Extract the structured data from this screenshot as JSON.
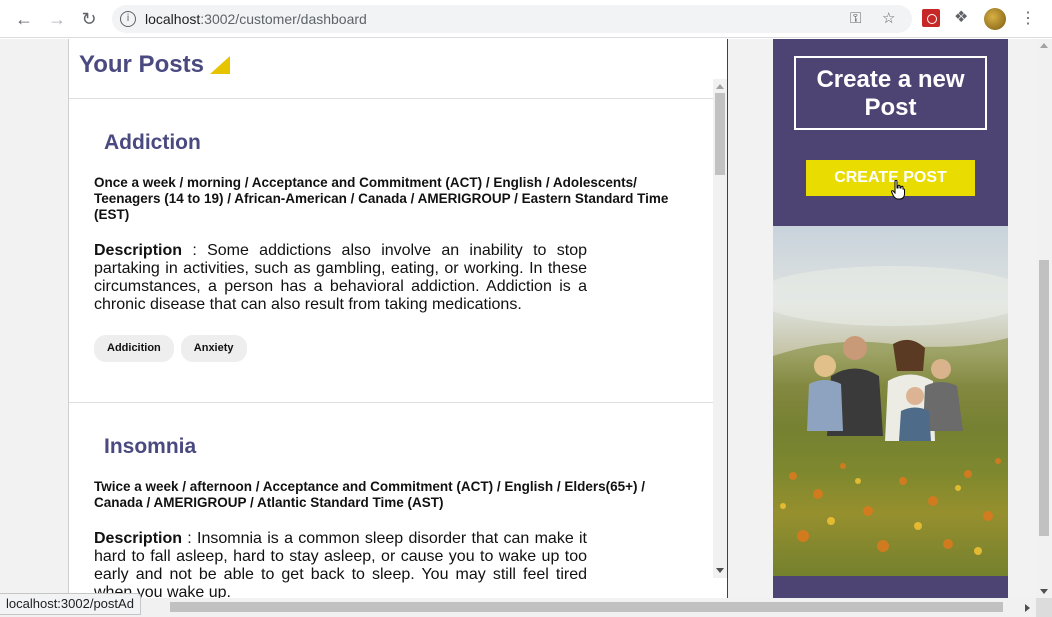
{
  "browser": {
    "url_host": "localhost",
    "url_path": ":3002/customer/dashboard",
    "status_url": "localhost:3002/postAd"
  },
  "panel": {
    "title": "Your Posts"
  },
  "posts": [
    {
      "title": "Addiction",
      "meta": "Once a week / morning / Acceptance and Commitment (ACT) / English / Adolescents/ Teenagers (14 to 19) / African-American / Canada / AMERIGROUP / Eastern Standard Time (EST)",
      "desc_label": "Description",
      "desc_text": " : Some addictions also involve an inability to stop partaking in activities, such as gambling, eating, or working. In these circumstances, a person has a behavioral addiction. Addiction is a chronic disease that can also result from taking medications.",
      "tags": [
        "Addicition",
        "Anxiety"
      ]
    },
    {
      "title": "Insomnia",
      "meta": "Twice a week / afternoon / Acceptance and Commitment (ACT) / English / Elders(65+) / Canada / AMERIGROUP / Atlantic Standard Time (AST)",
      "desc_label": "Description",
      "desc_text": " : Insomnia is a common sleep disorder that can make it hard to fall asleep, hard to stay asleep, or cause you to wake up too early and not be able to get back to sleep. You may still feel tired when you wake up."
    }
  ],
  "create_card": {
    "heading": "Create a new Post",
    "button_label": "CREATE POST"
  },
  "colors": {
    "brand_purple": "#4e4474",
    "title_purple": "#4a4a80",
    "accent_yellow": "#e8dc00"
  }
}
